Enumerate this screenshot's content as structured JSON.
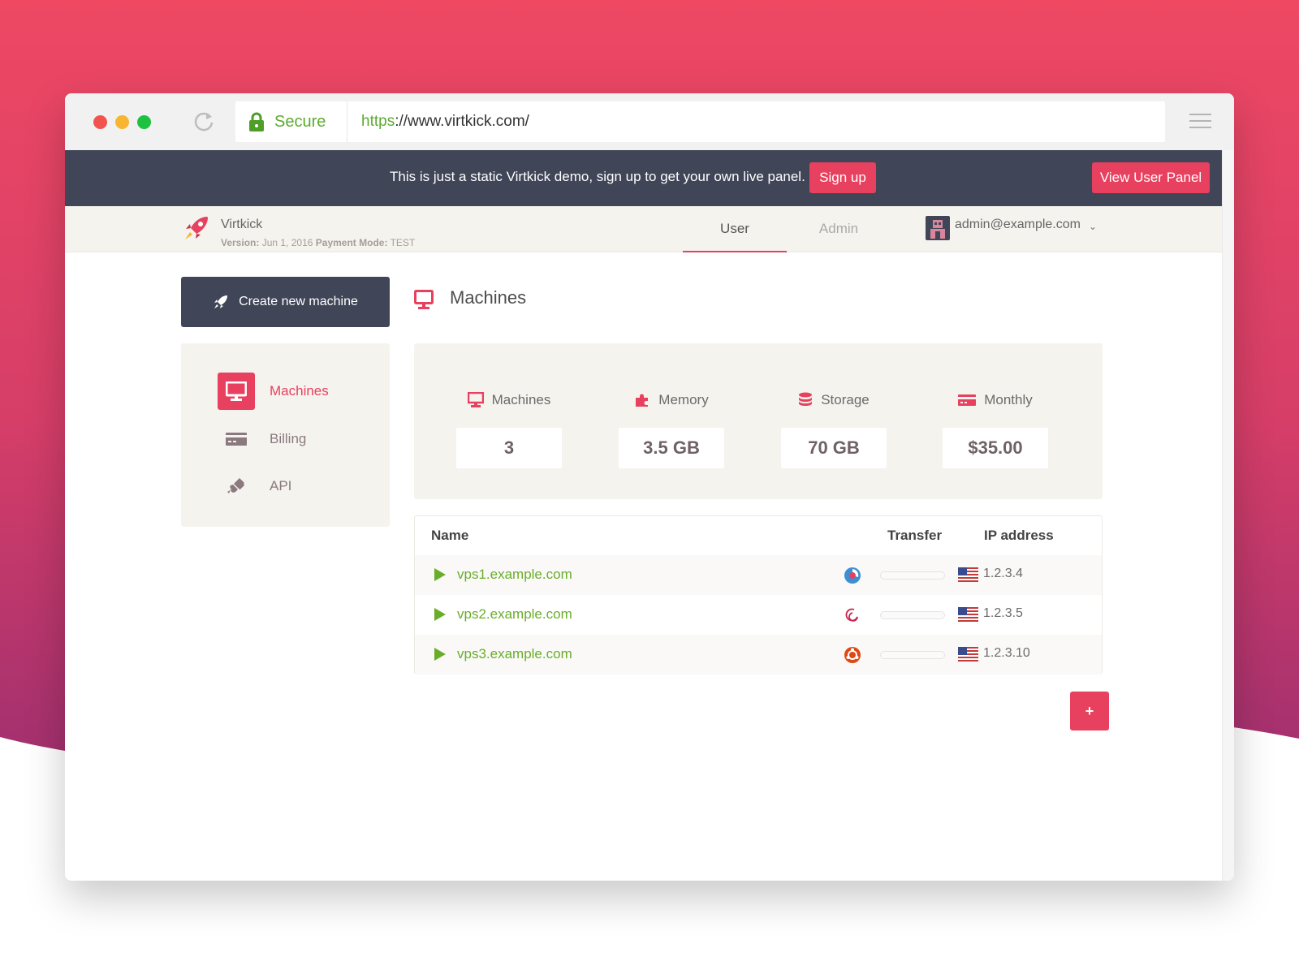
{
  "colors": {
    "accent": "#e8415f",
    "dark": "#404558",
    "success": "#6aad2a",
    "panel": "#f5f3ee"
  },
  "browser": {
    "secure_label": "Secure",
    "url_scheme": "https",
    "url_rest": "://www.virtkick.com/"
  },
  "demo_bar": {
    "text": "This is just a static Virtkick demo, sign up to get your own live panel.",
    "signup_label": "Sign up",
    "view_panel_label": "View User Panel"
  },
  "topnav": {
    "brand_name": "Virtkick",
    "version_label": "Version:",
    "version_value": "Jun 1, 2016",
    "payment_label": "Payment Mode:",
    "payment_value": "TEST",
    "tabs": [
      {
        "label": "User",
        "active": true
      },
      {
        "label": "Admin",
        "active": false
      }
    ],
    "user_email": "admin@example.com"
  },
  "sidebar": {
    "create_label": "Create new machine",
    "items": [
      {
        "label": "Machines",
        "icon": "monitor-icon",
        "active": true
      },
      {
        "label": "Billing",
        "icon": "credit-card-icon",
        "active": false
      },
      {
        "label": "API",
        "icon": "plug-icon",
        "active": false
      }
    ]
  },
  "main": {
    "title": "Machines",
    "stats": [
      {
        "label": "Machines",
        "value": "3",
        "icon": "monitor-icon"
      },
      {
        "label": "Memory",
        "value": "3.5 GB",
        "icon": "puzzle-icon"
      },
      {
        "label": "Storage",
        "value": "70 GB",
        "icon": "database-icon"
      },
      {
        "label": "Monthly",
        "value": "$35.00",
        "icon": "credit-card-icon"
      }
    ],
    "table": {
      "headers": {
        "name": "Name",
        "transfer": "Transfer",
        "ip": "IP address"
      },
      "rows": [
        {
          "name": "vps1.example.com",
          "os": "fedora-icon",
          "ip": "1.2.3.4",
          "flag": "us-flag-icon"
        },
        {
          "name": "vps2.example.com",
          "os": "debian-icon",
          "ip": "1.2.3.5",
          "flag": "us-flag-icon"
        },
        {
          "name": "vps3.example.com",
          "os": "ubuntu-icon",
          "ip": "1.2.3.10",
          "flag": "us-flag-icon"
        }
      ]
    },
    "add_label": "+"
  }
}
